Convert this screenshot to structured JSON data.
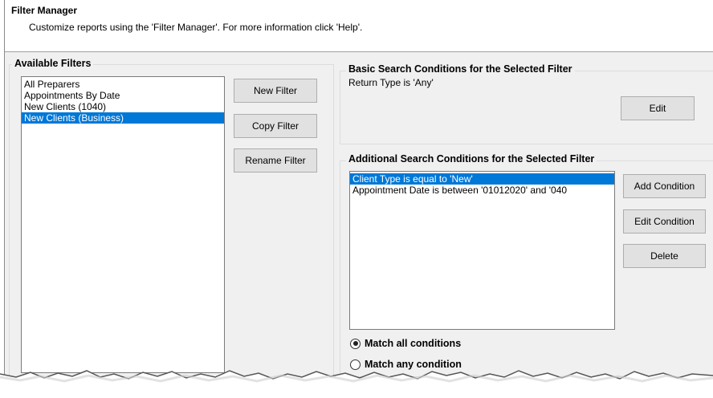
{
  "header": {
    "title": "Filter Manager",
    "description": "Customize reports using the 'Filter Manager'. For more information click 'Help'."
  },
  "available_filters": {
    "label": "Available Filters",
    "items": [
      {
        "label": "All Preparers",
        "selected": false
      },
      {
        "label": "Appointments By Date",
        "selected": false
      },
      {
        "label": "New Clients (1040)",
        "selected": false
      },
      {
        "label": "New Clients (Business)",
        "selected": true
      }
    ]
  },
  "filter_buttons": {
    "new": "New Filter",
    "copy": "Copy Filter",
    "rename": "Rename Filter"
  },
  "basic_conditions": {
    "label": "Basic Search Conditions for the Selected Filter",
    "text": "Return Type is 'Any'",
    "edit_button": "Edit"
  },
  "additional_conditions": {
    "label": "Additional Search Conditions for the Selected Filter",
    "items": [
      {
        "label": "Client Type is equal to 'New'",
        "selected": true
      },
      {
        "label": "Appointment Date is between '01012020' and '040",
        "selected": false
      }
    ],
    "add_button": "Add Condition",
    "edit_button": "Edit Condition",
    "delete_button": "Delete"
  },
  "match_options": {
    "all": {
      "label": "Match all conditions",
      "checked": true
    },
    "any": {
      "label": "Match any condition",
      "checked": false
    }
  },
  "colors": {
    "selection": "#0078d7",
    "dialog_bg": "#f0f0f0"
  }
}
